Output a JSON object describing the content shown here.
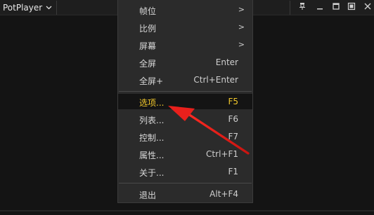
{
  "titlebar": {
    "app_name": "PotPlayer",
    "icons": [
      "chevron-down-icon",
      "pin-icon",
      "minimize-icon",
      "maximize-icon",
      "fullscreen-icon",
      "close-icon"
    ]
  },
  "menu": {
    "items": [
      {
        "label": "帧位",
        "shortcut": "",
        "submenu": true,
        "arrow": ">"
      },
      {
        "label": "比例",
        "shortcut": "",
        "submenu": true,
        "arrow": ">"
      },
      {
        "label": "屏幕",
        "shortcut": "",
        "submenu": true,
        "arrow": ">"
      },
      {
        "label": "全屏",
        "shortcut": "Enter",
        "submenu": false
      },
      {
        "label": "全屏+",
        "shortcut": "Ctrl+Enter",
        "submenu": false
      },
      {
        "label": "选项...",
        "shortcut": "F5",
        "submenu": false,
        "highlighted": true
      },
      {
        "label": "列表...",
        "shortcut": "F6",
        "submenu": false
      },
      {
        "label": "控制...",
        "shortcut": "F7",
        "submenu": false
      },
      {
        "label": "属性...",
        "shortcut": "Ctrl+F1",
        "submenu": false
      },
      {
        "label": "关于...",
        "shortcut": "F1",
        "submenu": false
      },
      {
        "label": "退出",
        "shortcut": "Alt+F4",
        "submenu": false
      }
    ]
  },
  "colors": {
    "background": "#141414",
    "menu_background": "#2b2b2b",
    "menu_text": "#d8d8d8",
    "highlight_text": "#f2c82b",
    "annotation_arrow": "#e8201c"
  }
}
